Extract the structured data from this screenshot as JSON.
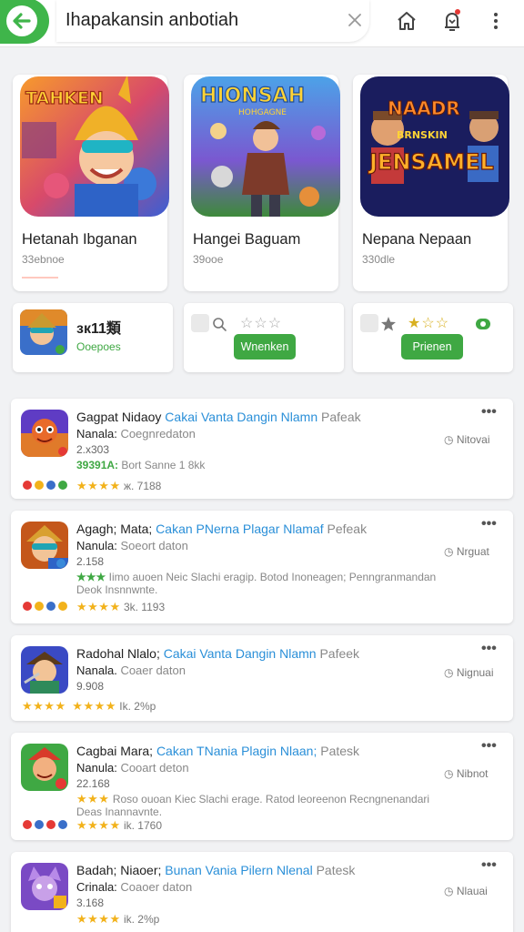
{
  "search": {
    "query": "Ihapakansin anbotiah"
  },
  "featured": [
    {
      "title": "Hetanah Ibganan",
      "subtitle": "33ebnoe",
      "art_text": "TAHKEN"
    },
    {
      "title": "Hangei Baguam",
      "subtitle": "39ooe",
      "art_text": "HIONSAH",
      "art_sub": "HOHGAGNE"
    },
    {
      "title": "Nepana Nepaan",
      "subtitle": "330dle",
      "art_text": "NAADR",
      "art_text2": "JENSAMEL",
      "art_sub": "BRNSKIN"
    }
  ],
  "quick": [
    {
      "title": "зк11類",
      "subtitle": "Ooepoes"
    },
    {
      "stars": "☆☆☆",
      "button": "Wnenken"
    },
    {
      "stars": "★☆☆",
      "button": "Prienen"
    }
  ],
  "list": [
    {
      "name": "Gagpat Nidaoy",
      "developer": "Cakai Vanta Dangin Nlamn",
      "publisher": "Pafeak",
      "name2": "Nanala:",
      "genre": "Coegnredaton",
      "downloads": "2.x303",
      "highlight": "39391A:",
      "highlight_rest": "Bort Sanne 1 8kk",
      "rating": "★★★★",
      "rating_text": "ж. 7188",
      "status": "Nitovai"
    },
    {
      "name": "Agagh; Matа;",
      "developer": "Cakan PNerna Plagar Nlamaf",
      "publisher": "Pefeak",
      "name2": "Nanula:",
      "genre": "Soeort daton",
      "downloads": "2.158",
      "desc_stars": "★★★",
      "desc_1": "Iimo auoen Neic Slachi eragip. Botod Inoneagen; Penngranmandan",
      "desc_2": "Deok Insnnwnte.",
      "rating": "★★★★",
      "rating_text": "3k. 1193",
      "status": "Nrguat"
    },
    {
      "name": "Radohal Nlalo;",
      "developer": "Cakai Vanta Dangin Nlamn",
      "publisher": "Pafeek",
      "name2": "Nanala.",
      "genre": "Coaer daton",
      "downloads": "9.908",
      "rating": "★★★★",
      "rating_text": "Ik. 2%p",
      "status": "Nignuai"
    },
    {
      "name": "Cagbai Marа;",
      "developer": "Cakan TNania Plagin Nlaan;",
      "publisher": "Patesk",
      "name2": "Nanula:",
      "genre": "Cooart deton",
      "downloads": "22.168",
      "desc_stars": "★★★",
      "desc_1": "Roso ouoan Kiec Slachi erage. Ratod leoreenon Recngnenandari",
      "desc_2": "Deas Inannavnte.",
      "rating": "★★★★",
      "rating_text": "ik. 1760",
      "status": "Nibnot"
    },
    {
      "name": "Badah; Niaoer;",
      "developer": "Bunan Vania Pilern Nlenal",
      "publisher": "Patesk",
      "name2": "Crinala:",
      "genre": "Coaoer daton",
      "downloads": "3.168",
      "rating": "★★★★",
      "rating_text": "ik. 2%p",
      "status": "Nlauai"
    }
  ],
  "colors": {
    "accent": "#3fa843",
    "link": "#2a8fd8",
    "star": "#f2b21b",
    "background": "#f1f2f4"
  },
  "icons": [
    "back-arrow-icon",
    "clear-icon",
    "home-icon",
    "notification-icon",
    "more-vert-icon",
    "more-horiz-icon",
    "clock-icon"
  ]
}
